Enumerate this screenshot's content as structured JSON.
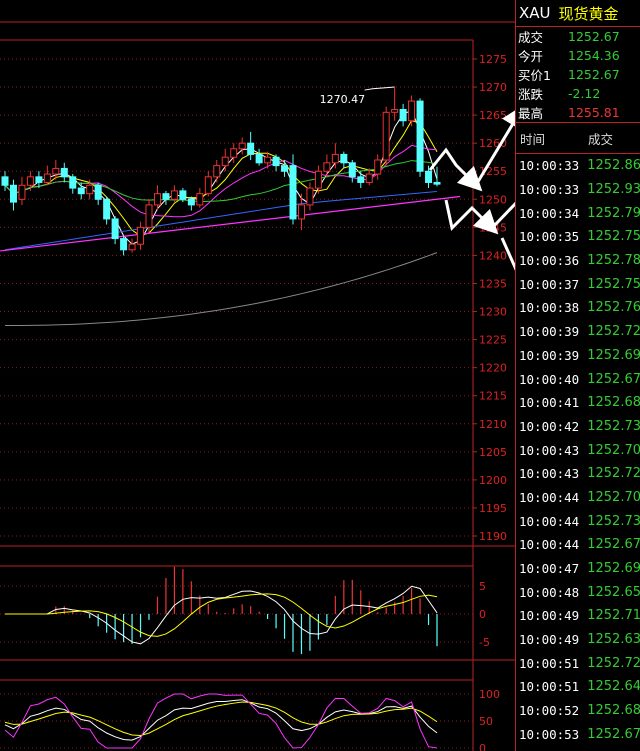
{
  "quote": {
    "symbol": "XAU",
    "name": "现货黄金",
    "rows": [
      {
        "label": "成交",
        "value": "1252.67",
        "color": "#33cc33"
      },
      {
        "label": "今开",
        "value": "1254.36",
        "color": "#33cc33"
      },
      {
        "label": "买价1",
        "value": "1252.67",
        "color": "#33cc33"
      },
      {
        "label": "涨跌",
        "value": "-2.12",
        "color": "#33cc33"
      },
      {
        "label": "最高",
        "value": "1255.81",
        "color": "#ee3333"
      }
    ]
  },
  "ticks": {
    "headers": [
      "时间",
      "成交"
    ],
    "rows": [
      {
        "time": "10:00:33",
        "price": "1252.86"
      },
      {
        "time": "10:00:33",
        "price": "1252.93"
      },
      {
        "time": "10:00:34",
        "price": "1252.79"
      },
      {
        "time": "10:00:35",
        "price": "1252.75"
      },
      {
        "time": "10:00:36",
        "price": "1252.78"
      },
      {
        "time": "10:00:37",
        "price": "1252.75"
      },
      {
        "time": "10:00:38",
        "price": "1252.76"
      },
      {
        "time": "10:00:39",
        "price": "1252.72"
      },
      {
        "time": "10:00:39",
        "price": "1252.69"
      },
      {
        "time": "10:00:40",
        "price": "1252.67"
      },
      {
        "time": "10:00:41",
        "price": "1252.68"
      },
      {
        "time": "10:00:42",
        "price": "1252.73"
      },
      {
        "time": "10:00:43",
        "price": "1252.70"
      },
      {
        "time": "10:00:43",
        "price": "1252.72"
      },
      {
        "time": "10:00:44",
        "price": "1252.70"
      },
      {
        "time": "10:00:44",
        "price": "1252.73"
      },
      {
        "time": "10:00:44",
        "price": "1252.67"
      },
      {
        "time": "10:00:47",
        "price": "1252.69"
      },
      {
        "time": "10:00:48",
        "price": "1252.65"
      },
      {
        "time": "10:00:49",
        "price": "1252.71"
      },
      {
        "time": "10:00:49",
        "price": "1252.63"
      },
      {
        "time": "10:00:51",
        "price": "1252.72"
      },
      {
        "time": "10:00:51",
        "price": "1252.64"
      },
      {
        "time": "10:00:52",
        "price": "1252.68"
      },
      {
        "time": "10:00:53",
        "price": "1252.67"
      }
    ]
  },
  "chart_data": {
    "type": "candlestick",
    "price_axis": {
      "ticks": [
        "1275",
        "1270",
        "1265",
        "1260",
        "1255",
        "1250",
        "1245",
        "1240",
        "1235",
        "1230",
        "1225",
        "1220",
        "1215",
        "1210",
        "1205",
        "1200",
        "1195",
        "1190"
      ],
      "ylim": [
        1190,
        1275
      ]
    },
    "annotation": "1270.47",
    "candles": [
      [
        1254,
        1252.5,
        1255,
        1251.5
      ],
      [
        1252.5,
        1249.5,
        1253.5,
        1248
      ],
      [
        1250,
        1252.5,
        1254,
        1249
      ],
      [
        1252.5,
        1254,
        1255,
        1251.5
      ],
      [
        1254,
        1253,
        1255,
        1252
      ],
      [
        1253,
        1254.5,
        1256,
        1252.5
      ],
      [
        1254.5,
        1255.5,
        1257,
        1253.5
      ],
      [
        1255.5,
        1254,
        1256.5,
        1253
      ],
      [
        1254,
        1252,
        1254.5,
        1251
      ],
      [
        1252,
        1251,
        1253,
        1250
      ],
      [
        1251,
        1252.5,
        1253.5,
        1250
      ],
      [
        1252.5,
        1250,
        1253,
        1249
      ],
      [
        1250,
        1246.5,
        1250.5,
        1245.5
      ],
      [
        1246.5,
        1243,
        1247,
        1242
      ],
      [
        1243,
        1241,
        1243.5,
        1240
      ],
      [
        1241,
        1242,
        1243,
        1240.5
      ],
      [
        1242,
        1245,
        1246,
        1241
      ],
      [
        1245,
        1249,
        1250,
        1244
      ],
      [
        1249,
        1251,
        1252.5,
        1248
      ],
      [
        1251,
        1250,
        1251.5,
        1249
      ],
      [
        1250,
        1251.5,
        1252.5,
        1249.5
      ],
      [
        1251.5,
        1250,
        1252,
        1249.5
      ],
      [
        1250,
        1249,
        1250.5,
        1248
      ],
      [
        1249,
        1251,
        1252,
        1248.5
      ],
      [
        1251,
        1254,
        1255,
        1250.5
      ],
      [
        1254,
        1256,
        1257,
        1253
      ],
      [
        1256,
        1257.5,
        1259,
        1255
      ],
      [
        1257.5,
        1259,
        1260,
        1256.5
      ],
      [
        1259,
        1260,
        1261,
        1258
      ],
      [
        1260,
        1258,
        1262,
        1257
      ],
      [
        1258,
        1256.5,
        1259,
        1256
      ],
      [
        1256.5,
        1257.5,
        1258.5,
        1255.5
      ],
      [
        1257.5,
        1256,
        1258,
        1255
      ],
      [
        1256,
        1255,
        1257,
        1254
      ],
      [
        1256,
        1246.5,
        1258,
        1245.5
      ],
      [
        1246.5,
        1249,
        1251,
        1244.5
      ],
      [
        1249,
        1252,
        1253,
        1248
      ],
      [
        1252,
        1255,
        1256,
        1251
      ],
      [
        1255,
        1256.5,
        1258,
        1254
      ],
      [
        1256.5,
        1258,
        1260,
        1255.5
      ],
      [
        1258,
        1256.5,
        1258.5,
        1255.5
      ],
      [
        1256.5,
        1254,
        1257,
        1253
      ],
      [
        1254,
        1253,
        1255,
        1252
      ],
      [
        1253,
        1254.5,
        1255.5,
        1252.5
      ],
      [
        1254.5,
        1257,
        1258,
        1253.5
      ],
      [
        1257,
        1265.5,
        1266.5,
        1256
      ],
      [
        1265.5,
        1266,
        1270,
        1264
      ],
      [
        1266,
        1264,
        1267,
        1263
      ],
      [
        1264,
        1267.5,
        1268.5,
        1263
      ],
      [
        1267.5,
        1255,
        1268,
        1254
      ],
      [
        1255,
        1253,
        1256,
        1252
      ],
      [
        1253,
        1252.7,
        1255.8,
        1252.3
      ]
    ]
  },
  "macd_axis": {
    "ticks": [
      "5",
      "0",
      "-5"
    ]
  },
  "kdj_axis": {
    "ticks": [
      "100",
      "50",
      "0"
    ]
  }
}
